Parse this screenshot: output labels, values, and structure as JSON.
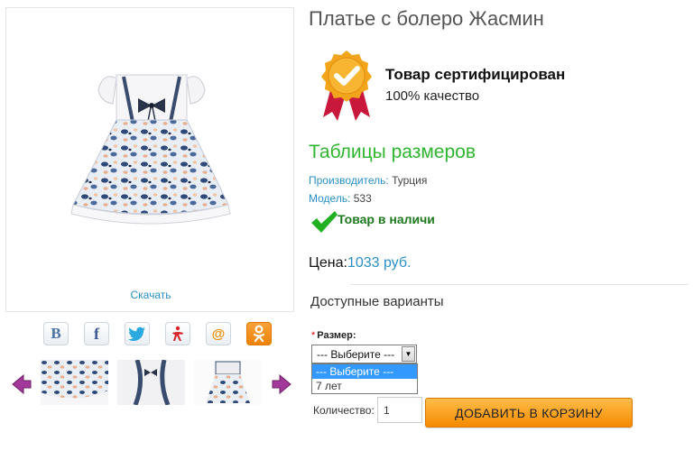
{
  "product": {
    "title": "Платье с болеро Жасмин",
    "download_label": "Скачать",
    "certified_title": "Товар сертифицирован",
    "certified_subtitle": "100% качество",
    "size_table_link": "Таблицы размеров",
    "manufacturer_label": "Производитель:",
    "manufacturer_value": "Турция",
    "model_label": "Модель:",
    "model_value": "533",
    "stock_status": "Товар в наличи",
    "price_label": "Цена:",
    "price_value": "1033 руб."
  },
  "social": [
    {
      "name": "vk",
      "icon": "vk-icon",
      "glyph": "B"
    },
    {
      "name": "facebook",
      "icon": "facebook-icon",
      "glyph": "f"
    },
    {
      "name": "twitter",
      "icon": "twitter-icon",
      "glyph": ""
    },
    {
      "name": "moikrug",
      "icon": "moikrug-icon",
      "glyph": ""
    },
    {
      "name": "mailru",
      "icon": "mailru-icon",
      "glyph": "@"
    },
    {
      "name": "odnoklassniki",
      "icon": "odnoklassniki-icon",
      "glyph": ""
    }
  ],
  "variants": {
    "title": "Доступные варианты",
    "required_mark": "*",
    "size_label": "Размер:",
    "select_value": "--- Выберите ---",
    "options": [
      "--- Выберите ---",
      "7 лет"
    ],
    "selected_index": 0
  },
  "cart": {
    "quantity_label": "Количество:",
    "quantity_value": "1",
    "add_button": "ДОБАВИТЬ В КОРЗИНУ"
  },
  "colors": {
    "accent_blue": "#2a8fc5",
    "accent_green": "#2fb52f",
    "button_orange": "#f58a00",
    "badge_gold": "#f2a41b",
    "ribbon_red": "#c8183c"
  }
}
